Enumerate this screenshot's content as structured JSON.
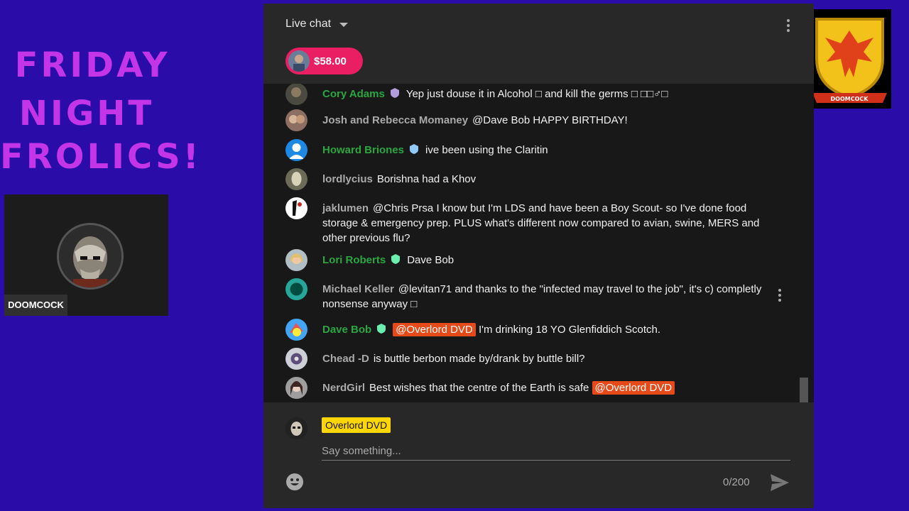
{
  "overlay": {
    "title_lines": [
      "FRIDAY",
      "NIGHT",
      "FROLICS!"
    ],
    "webcam_name": "DOOMCOCK",
    "logo_text": "DOOMCOCK"
  },
  "chat": {
    "header_title": "Live chat",
    "superchat_amount": "$58.00",
    "messages": [
      {
        "author": "Cory Adams",
        "member": true,
        "text": "Yep just douse it in Alcohol □ and kill the germs □ □□♂□"
      },
      {
        "author": "Josh and Rebecca Momaney",
        "member": false,
        "text": "@Dave Bob HAPPY BIRTHDAY!"
      },
      {
        "author": "Howard Briones",
        "member": true,
        "text": "ive been using the Claritin"
      },
      {
        "author": "lordlycius",
        "member": false,
        "text": "Borishna had a Khov"
      },
      {
        "author": "jaklumen",
        "member": false,
        "text": "@Chris Prsa I know but I'm LDS and have been a Boy Scout- so I've done food storage & emergency prep. PLUS what's different now compared to avian, swine, MERS and other previous flu?"
      },
      {
        "author": "Lori Roberts",
        "member": true,
        "text": "Dave Bob"
      },
      {
        "author": "Michael Keller",
        "member": false,
        "text": "@levitan71 and thanks to the \"infected may travel to the job\", it's c) completly nonsense anyway □"
      },
      {
        "author": "Dave Bob",
        "member": true,
        "mention": "@Overlord DVD",
        "text": "I'm drinking 18 YO Glenfiddich Scotch."
      },
      {
        "author": "Chead -D",
        "member": false,
        "text": "is buttle berbon made by/drank by buttle bill?"
      },
      {
        "author": "NerdGirl",
        "member": false,
        "text": "Best wishes that the centre of the Earth is safe",
        "mention_after": "@Overlord DVD"
      }
    ],
    "composer": {
      "user_name": "Overlord DVD",
      "placeholder": "Say something...",
      "counter": "0/200"
    }
  },
  "colors": {
    "background": "#2a0ca8",
    "title": "#c535e8",
    "member_name": "#2ba640",
    "superchat": "#e91e63",
    "mention": "#e64a19",
    "owner_chip": "#ffd600"
  }
}
